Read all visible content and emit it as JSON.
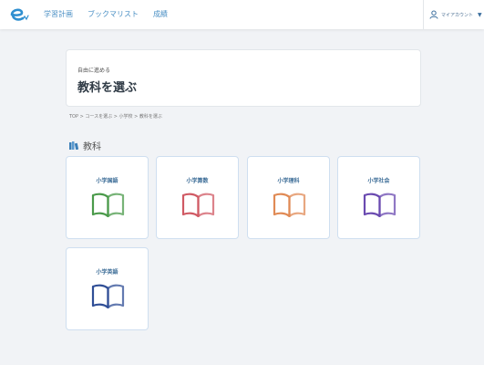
{
  "header": {
    "nav": [
      "学習計画",
      "ブックマリスト",
      "成績"
    ],
    "account_label": "マイアカウント"
  },
  "title_card": {
    "subtitle": "自由に進める",
    "title": "教科を選ぶ"
  },
  "breadcrumb": "TOP > コースを選ぶ > 小学校 > 教科を選ぶ",
  "section": {
    "title": "教科"
  },
  "subjects": [
    {
      "label": "小学国語",
      "color": "#4a9a4a"
    },
    {
      "label": "小学算数",
      "color": "#d05a64"
    },
    {
      "label": "小学理科",
      "color": "#e08a55"
    },
    {
      "label": "小学社会",
      "color": "#6a4ab0"
    },
    {
      "label": "小学英語",
      "color": "#2f4e96"
    }
  ],
  "colors": {
    "accent": "#4a8fc4",
    "background": "#f1f3f6",
    "card_border": "#cfdff0"
  },
  "icons": {
    "logo": "e-logo-icon",
    "account": "user-icon",
    "section": "books-icon",
    "subject": "open-book-icon"
  }
}
